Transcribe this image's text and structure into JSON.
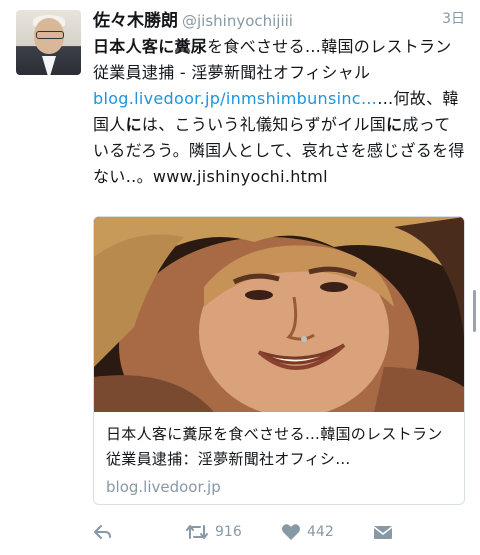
{
  "tweet": {
    "name": "佐々木勝朗",
    "handle": "@jishinyochijiii",
    "time": "3日",
    "text_parts": {
      "p1": "日本人客に糞尿",
      "p2": "を食べさせる…韓国のレストラン従業員逮捕 - 淫夢新聞社オフィシャル ",
      "p3": "blog.livedoor.jp/inmshimbunsinc…",
      "p4": "…何故、韓国人",
      "p5": "に",
      "p6": "は、こういう礼儀知らずがイル国",
      "p7": "に",
      "p8": "成っているだろう。隣国人として、哀れさを感じざるを得ない‥。www.jishinyochi.html"
    }
  },
  "card": {
    "title": "日本人客に糞尿を食べさせる…韓国のレストラン従業員逮捕：淫夢新聞社オフィシ…",
    "domain": "blog.livedoor.jp"
  },
  "actions": {
    "reply_icon": "reply-icon",
    "retweet_icon": "retweet-icon",
    "retweet_count": "916",
    "like_icon": "heart-icon",
    "like_count": "442",
    "dm_icon": "envelope-icon"
  },
  "colors": {
    "link": "#1b95e0",
    "muted": "#8899a6",
    "text": "#14171a"
  }
}
